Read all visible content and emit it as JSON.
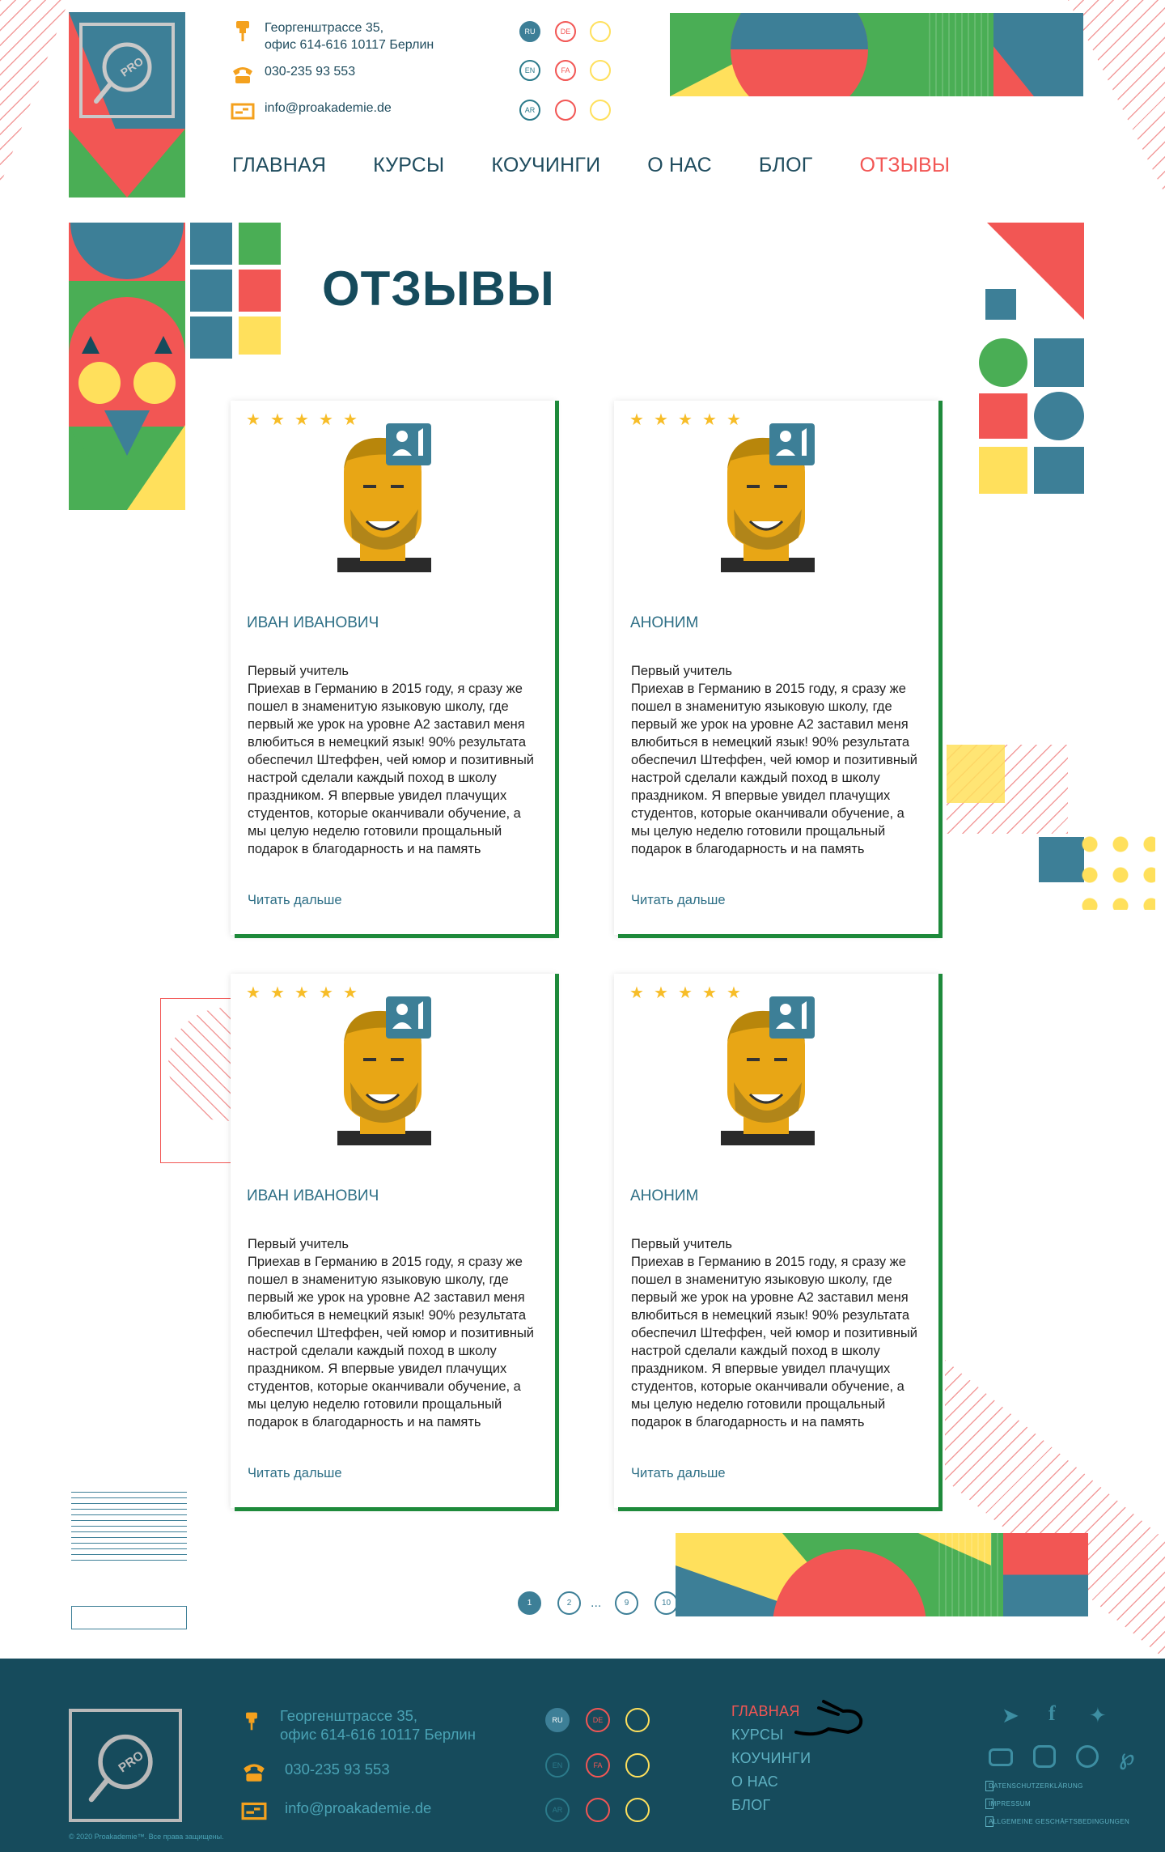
{
  "header": {
    "address_line1": "Георгенштрассе 35,",
    "address_line2": "офис 614-616 10117 Берлин",
    "phone": "030-235 93 553",
    "email": "info@proakademie.de",
    "logo_text": "PRO",
    "languages": [
      "RU",
      "DE",
      "EN",
      "FA",
      "AR"
    ],
    "nav": [
      "ГЛАВНАЯ",
      "КУРСЫ",
      "КОУЧИНГИ",
      "О НАС",
      "БЛОГ",
      "ОТЗЫВЫ"
    ],
    "active_nav": "ОТЗЫВЫ"
  },
  "page": {
    "title": "ОТЗЫВЫ"
  },
  "reviews": [
    {
      "name": "ИВАН ИВАНОВИЧ",
      "rating": 5,
      "text": "Первый учитель\nПриехав в Германию в 2015 году, я сразу же пошел в знаменитую языковую школу, где первый же урок на уровне А2 заставил меня влюбиться в немецкий язык! 90% результата обеспечил Штеффен, чей юмор и позитивный настрой сделали каждый поход в школу праздником. Я впервые увидел плачущих студентов, которые оканчивали обучение, а мы целую неделю готовили прощальный подарок в благодарность и на память",
      "more": "Читать дальше"
    },
    {
      "name": "АНОНИМ",
      "rating": 5,
      "text": "Первый учитель\nПриехав в Германию в 2015 году, я сразу же пошел в знаменитую языковую школу, где первый же урок на уровне А2 заставил меня влюбиться в немецкий язык! 90% результата обеспечил Штеффен, чей юмор и позитивный настрой сделали каждый поход в школу праздником. Я впервые увидел плачущих студентов, которые оканчивали обучение, а мы целую неделю готовили прощальный подарок в благодарность и на память",
      "more": "Читать дальше"
    },
    {
      "name": "ИВАН ИВАНОВИЧ",
      "rating": 5,
      "text": "Первый учитель\nПриехав в Германию в 2015 году, я сразу же пошел в знаменитую языковую школу, где первый же урок на уровне А2 заставил меня влюбиться в немецкий язык! 90% результата обеспечил Штеффен, чей юмор и позитивный настрой сделали каждый поход в школу праздником. Я впервые увидел плачущих студентов, которые оканчивали обучение, а мы целую неделю готовили прощальный подарок в благодарность и на память",
      "more": "Читать дальше"
    },
    {
      "name": "АНОНИМ",
      "rating": 5,
      "text": "Первый учитель\nПриехав в Германию в 2015 году, я сразу же пошел в знаменитую языковую школу, где первый же урок на уровне А2 заставил меня влюбиться в немецкий язык! 90% результата обеспечил Штеффен, чей юмор и позитивный настрой сделали каждый поход в школу праздником. Я впервые увидел плачущих студентов, которые оканчивали обучение, а мы целую неделю готовили прощальный подарок в благодарность и на память",
      "more": "Читать дальше"
    }
  ],
  "pagination": {
    "pages": [
      "1",
      "2",
      "9",
      "10"
    ],
    "ellipsis": "...",
    "current": "1"
  },
  "footer": {
    "address_line1": "Георгенштрассе 35,",
    "address_line2": "офис 614-616 10117 Берлин",
    "phone": "030-235 93 553",
    "email": "info@proakademie.de",
    "languages": [
      "RU",
      "DE",
      "EN",
      "FA",
      "AR"
    ],
    "nav": [
      "ГЛАВНАЯ",
      "КУРСЫ",
      "КОУЧИНГИ",
      "О НАС",
      "БЛОГ"
    ],
    "links": [
      "DATENSCHUTZERKLÄRUNG",
      "IMPRESSUM",
      "ALLGEMEINE GESCHÄFTSBEDINGUNGEN"
    ],
    "copyright": "© 2020 Proakademie™. Все права защищены."
  },
  "colors": {
    "green": "#4aae55",
    "teal": "#3d7f97",
    "red": "#f25654",
    "yellow": "#ffe05c",
    "dark": "#164b5c"
  },
  "icons": {
    "address": "pin-icon",
    "phone": "phone-icon",
    "email": "email-icon",
    "rating": "star-icon",
    "avatar": "user-badge-icon"
  }
}
